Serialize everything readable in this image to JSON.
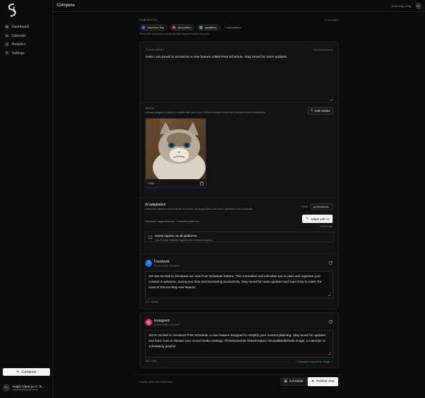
{
  "sidebar": {
    "items": [
      {
        "label": "Dashboard",
        "icon": "grid-icon"
      },
      {
        "label": "Calendar",
        "icon": "calendar-icon"
      },
      {
        "label": "Analytics",
        "icon": "chart-icon"
      },
      {
        "label": "Settings",
        "icon": "gear-icon"
      }
    ],
    "compose_label": "Compose",
    "user": {
      "initials": "RC",
      "name": "Ralph Clarence C. B...",
      "email": "ralpheba@gmail.com"
    }
  },
  "header": {
    "title": "Compose",
    "timezone": "Asia/Hong_Kong",
    "avatar_initials": "RC"
  },
  "publish": {
    "label": "PUBLISH TO",
    "selected_count": "2 selected",
    "accounts": [
      {
        "name": "Valorthun Test",
        "color": "#1877f2"
      },
      {
        "name": "@valorthun",
        "color": "#e1306c"
      },
      {
        "name": "greatthink",
        "color": "#3aa6a0"
      }
    ],
    "add_label": "+ Add platform",
    "hint": "Select the connected accounts that should receive this post."
  },
  "draft": {
    "label": "YOUR DRAFT",
    "char_count": "85 characters",
    "text": "Hello I am proud to announce a new feature called Post Schedule. Stay tuned for more updates."
  },
  "media": {
    "label": "MEDIA",
    "hint": "Upload images or video to include with your post. Platform requirements are checked before publishing.",
    "add_label": "Add media",
    "item_label": "Image"
  },
  "ai": {
    "title": "AI adaptation",
    "subtitle": "Generate platform-native drafts for review. AI suggestions are never published automatically.",
    "tone_label": "TONE",
    "tone_value": "professional",
    "generate_hint": "Generate suggestions for 2 selected platforms.",
    "adapt_label": "Adapt with AI",
    "usage": "16/20 today",
    "same_caption_title": "Same caption on all platforms",
    "same_caption_sub": "One AI draft, reviewed against each selected platform."
  },
  "facebook": {
    "name": "Facebook",
    "sub": "PLATFORM VARIANT",
    "text": "We are excited to introduce our new Post Schedule feature. This innovative tool will allow you to plan and organize your content in advance, saving you time and increasing productivity. Stay tuned for more updates and learn how to make the most of this exciting new feature.",
    "count": "274 / 63206"
  },
  "instagram": {
    "name": "Instagram",
    "sub": "PLATFORM VARIANT",
    "text": "We're excited to introduce Post Schedule, a new feature designed to simplify your content planning. Stay tuned for updates and learn how to elevate your social media strategy. #PostSchedule #NewFeature #SocialMediaTools image: a calendar or scheduling graphic",
    "count": "208 / 2200",
    "note": "✓ Instagram requires an image ✓"
  },
  "footer": {
    "auto_save": "Drafts save automatically",
    "schedule_label": "Schedule",
    "publish_label": "Publish now"
  },
  "colors": {
    "facebook": "#1877f2",
    "instagram": "#e1306c",
    "success": "#4caf7a"
  }
}
